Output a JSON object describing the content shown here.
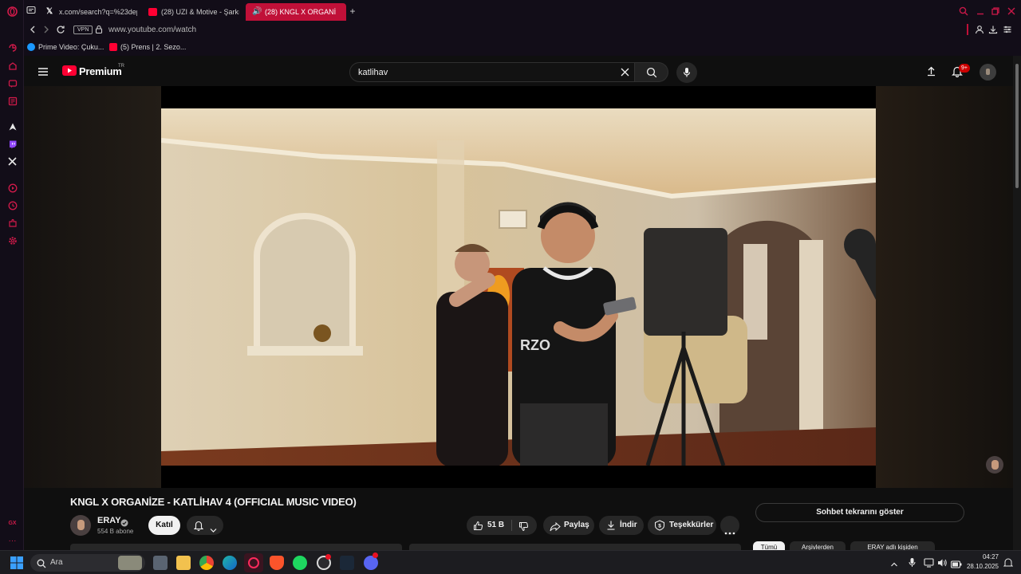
{
  "browser": {
    "tabs": [
      {
        "title": "x.com/search?q=%23dep",
        "active": false
      },
      {
        "title": "(28) UZI & Motive - Şarkı",
        "active": false
      },
      {
        "title": "(28) KNGL X ORGANİ",
        "active": true
      }
    ],
    "new_tab_label": "+",
    "vpn_badge": "VPN",
    "url": "www.youtube.com/watch",
    "bookmarks": [
      {
        "label": "Prime Video: Çuku..."
      },
      {
        "label": "(5) Prens | 2. Sezo..."
      }
    ],
    "accent": "#c01038"
  },
  "youtube": {
    "logo_text": "Premium",
    "logo_region": "TR",
    "search_value": "katlihav",
    "notification_badge": "9+",
    "video": {
      "title": "KNGL X ORGANİZE - KATLİHAV 4 (OFFICIAL MUSIC VIDEO)",
      "channel": "ERAY",
      "subscribers": "554 B abone",
      "join_label": "Katıl",
      "likes": "51 B",
      "share_label": "Paylaş",
      "download_label": "İndir",
      "thanks_label": "Teşekkürler"
    },
    "chat_replay_label": "Sohbet tekrarını göster",
    "chips": [
      "Tümü",
      "Arşivlerden",
      "ERAY adlı kişiden"
    ]
  },
  "taskbar": {
    "search_placeholder": "Ara",
    "time": "04:27",
    "date": "28.10.2025"
  }
}
